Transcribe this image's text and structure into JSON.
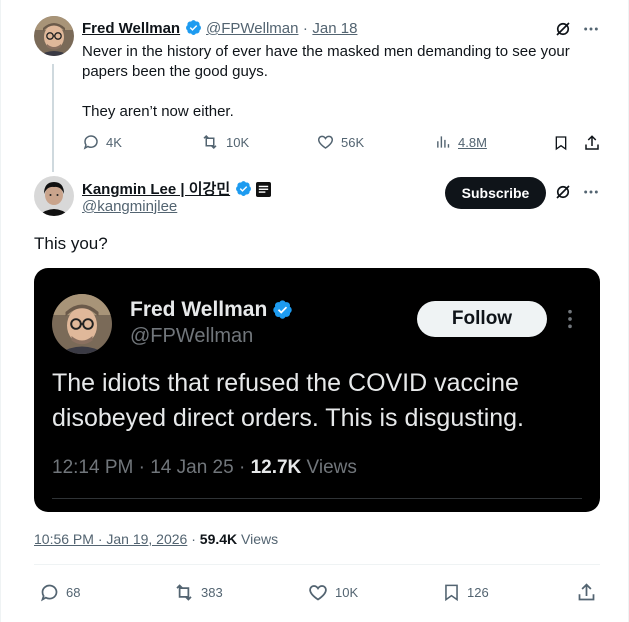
{
  "tweet1": {
    "name": "Fred Wellman",
    "handle": "@FPWellman",
    "separator": "·",
    "date": "Jan 18",
    "text_line1": "Never in the history of ever have the masked men demanding to see your",
    "text_line2": "papers been the good guys.",
    "text_line3": "They aren’t now either.",
    "replies": "4K",
    "reposts": "10K",
    "likes": "56K",
    "views": "4.8M"
  },
  "tweet2": {
    "name": "Kangmin Lee | 이강민",
    "handle": "@kangminjlee",
    "subscribe_label": "Subscribe",
    "text": "This you?",
    "meta_time": "10:56 PM · Jan 19, 2026",
    "meta_dot": "·",
    "meta_views_count": "59.4K",
    "meta_views_label": "Views",
    "replies": "68",
    "reposts": "383",
    "likes": "10K",
    "bookmarks": "126"
  },
  "embedded": {
    "name": "Fred Wellman",
    "handle": "@FPWellman",
    "follow_label": "Follow",
    "text_line1": "The idiots that refused the COVID vaccine",
    "text_line2": "disobeyed direct orders. This is disgusting.",
    "time": "12:14 PM · 14 Jan 25 · ",
    "views_count": "12.7K",
    "views_label": "Views"
  },
  "colors": {
    "verified": "#1d9bf0",
    "text": "#0f1419",
    "muted": "#536471",
    "card_bg": "#000000"
  }
}
